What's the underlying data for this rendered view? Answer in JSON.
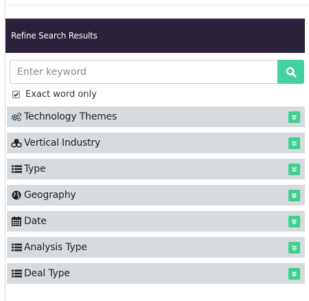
{
  "panel": {
    "title": "Refine Search Results"
  },
  "search": {
    "placeholder": "Enter keyword",
    "value": "",
    "button_icon": "search-icon"
  },
  "exact_word": {
    "label": "Exact word only",
    "checked": true
  },
  "facets": [
    {
      "label": "Technology Themes",
      "icon": "gears-icon"
    },
    {
      "label": "Vertical Industry",
      "icon": "cubes-icon"
    },
    {
      "label": "Type",
      "icon": "list-icon"
    },
    {
      "label": "Geography",
      "icon": "globe-icon"
    },
    {
      "label": "Date",
      "icon": "calendar-icon"
    },
    {
      "label": "Analysis Type",
      "icon": "list-icon"
    },
    {
      "label": "Deal Type",
      "icon": "list-icon"
    }
  ],
  "colors": {
    "header_bg": "#2b2138",
    "accent": "#45d0a3",
    "facet_bg": "#d6dbdf",
    "toggle": "#3fcf8e"
  }
}
